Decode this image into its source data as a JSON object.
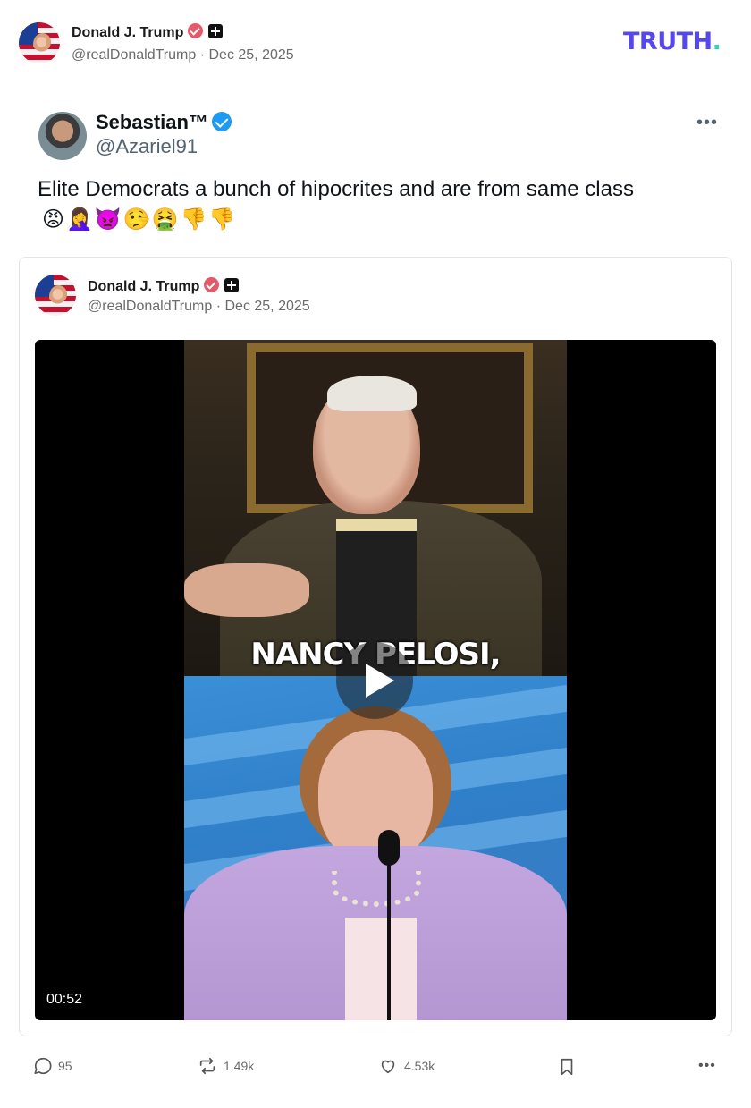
{
  "post": {
    "author_name": "Donald J. Trump",
    "author_handle": "@realDonaldTrump",
    "date": "Dec 25, 2025",
    "brand_logo": "TRUTH",
    "brand_dot": "."
  },
  "embedded_post": {
    "author_name": "Sebastian™",
    "author_handle": "@Azariel91",
    "text": "Elite Democrats a bunch of hipocrites and are from same class",
    "emojis": "😡🤦‍♀️👿🤥🤮👎👎",
    "more_label": "•••"
  },
  "quoted_post": {
    "author_name": "Donald J. Trump",
    "author_handle": "@realDonaldTrump",
    "date": "Dec 25, 2025",
    "video": {
      "caption": "NANCY PELOSI,",
      "duration": "00:52"
    }
  },
  "actions": {
    "replies": "95",
    "retruths": "1.49k",
    "likes": "4.53k",
    "more_label": "•••"
  },
  "icons": {
    "verified": "verified-badge-icon",
    "plus": "plus-badge-icon",
    "reply": "comment-icon",
    "retruth": "repost-icon",
    "like": "heart-icon",
    "bookmark": "bookmark-icon",
    "more": "more-icon",
    "play": "play-icon"
  },
  "colors": {
    "brand_purple": "#5448ee",
    "brand_teal": "#2fd6b4",
    "x_verified_blue": "#1d9bf0",
    "verified_red": "#e45a6a",
    "muted_text": "#6b6b6b"
  }
}
